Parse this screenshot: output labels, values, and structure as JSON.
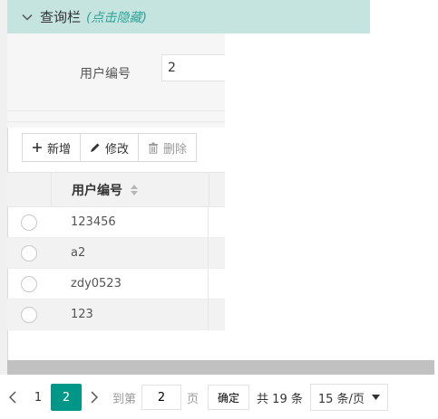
{
  "query_bar": {
    "title": "查询栏",
    "hint": "(点击隐藏)"
  },
  "form": {
    "user_id_label": "用户编号",
    "user_id_value": "2"
  },
  "toolbar": {
    "add": "新增",
    "edit": "修改",
    "delete": "删除"
  },
  "table": {
    "columns": [
      "用户编号"
    ],
    "rows": [
      {
        "user_id": "123456"
      },
      {
        "user_id": "a2"
      },
      {
        "user_id": "zdy0523"
      },
      {
        "user_id": "123"
      }
    ]
  },
  "pagination": {
    "prev_icon": "chevron-left-icon",
    "next_icon": "chevron-right-icon",
    "pages": [
      "1",
      "2"
    ],
    "current_page": "2",
    "goto_prefix": "到第",
    "goto_value": "2",
    "goto_suffix": "页",
    "confirm": "确定",
    "total": "共 19 条",
    "page_size": "15 条/页"
  },
  "colors": {
    "accent": "#009688",
    "query_bar_bg": "#c5e3df",
    "hint": "#2fa59a"
  }
}
